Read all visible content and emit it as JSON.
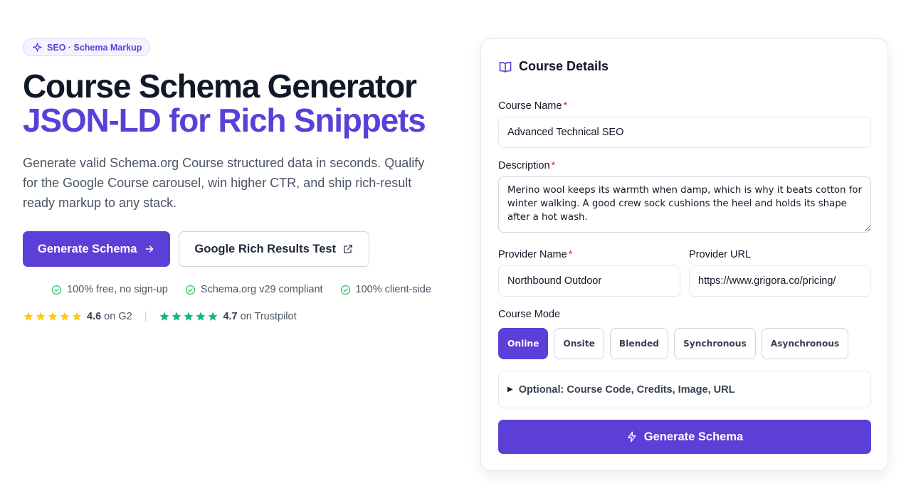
{
  "hero": {
    "badge": "SEO · Schema Markup",
    "title_line1": "Course Schema Generator",
    "title_line2": "JSON-LD for Rich Snippets",
    "lead": "Generate valid Schema.org Course structured data in seconds. Qualify for the Google Course carousel, win higher CTR, and ship rich-result ready markup to any stack.",
    "primary_cta": "Generate Schema",
    "secondary_cta": "Google Rich Results Test",
    "checks": [
      "100% free, no sign-up",
      "Schema.org v29 compliant",
      "100% client-side"
    ],
    "ratings": [
      {
        "score": "4.6",
        "platform": "on G2",
        "star_color": "#facc15"
      },
      {
        "score": "4.7",
        "platform": "on Trustpilot",
        "star_color": "#10b981"
      }
    ],
    "separator": "|"
  },
  "form": {
    "title": "Course Details",
    "course_name_label": "Course Name",
    "course_name_value": "Advanced Technical SEO",
    "description_label": "Description",
    "description_value": "Merino wool keeps its warmth when damp, which is why it beats cotton for winter walking. A good crew sock cushions the heel and holds its shape after a hot wash.",
    "provider_name_label": "Provider Name",
    "provider_name_value": "Northbound Outdoor",
    "provider_url_label": "Provider URL",
    "provider_url_value": "https://www.grigora.co/pricing/",
    "required_mark": "*",
    "course_mode_label": "Course Mode",
    "modes": [
      "Online",
      "Onsite",
      "Blended",
      "Synchronous",
      "Asynchronous"
    ],
    "selected_mode": "Online",
    "optional_label": "Optional: Course Code, Credits, Image, URL",
    "submit_label": "Generate Schema"
  },
  "colors": {
    "accent": "#5b3fd6",
    "text": "#111827",
    "muted": "#4b5563",
    "check_green": "#22c55e",
    "required_red": "#dc2626"
  },
  "icons": {
    "badge": "sparkle-icon",
    "primary_cta": "arrow-right-icon",
    "secondary_cta": "external-link-icon",
    "check": "check-circle-icon",
    "star": "star-icon",
    "card_title": "book-open-icon",
    "submit": "lightning-icon",
    "optional": "triangle-right-icon"
  }
}
